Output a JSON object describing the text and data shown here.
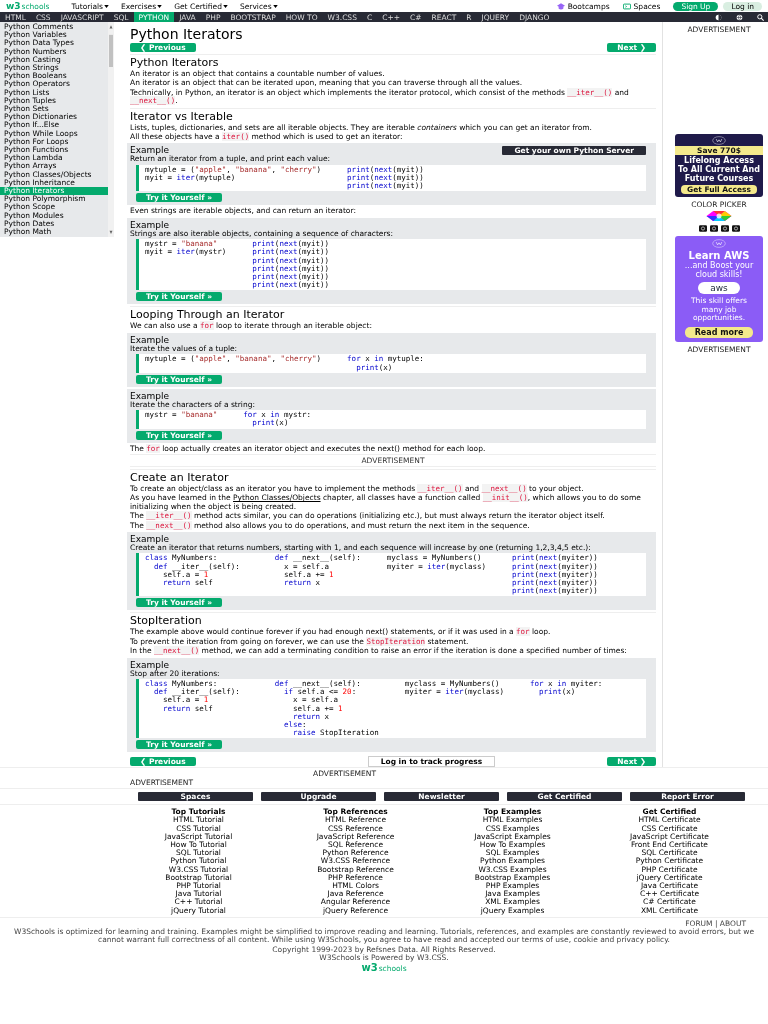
{
  "header": {
    "logo": {
      "mark": "w3",
      "sub": "schools"
    },
    "menus": [
      {
        "label": "Tutorials"
      },
      {
        "label": "Exercises"
      },
      {
        "label": "Get Certified"
      },
      {
        "label": "Services"
      }
    ],
    "links": [
      {
        "label": "Bootcamps"
      },
      {
        "label": "Spaces"
      }
    ],
    "sign_up": "Sign Up",
    "log_in": "Log in"
  },
  "nav": [
    {
      "label": "HTML",
      "selected": false
    },
    {
      "label": "CSS",
      "selected": false
    },
    {
      "label": "JAVASCRIPT",
      "selected": false
    },
    {
      "label": "SQL",
      "selected": false
    },
    {
      "label": "PYTHON",
      "selected": true
    },
    {
      "label": "JAVA",
      "selected": false
    },
    {
      "label": "PHP",
      "selected": false
    },
    {
      "label": "BOOTSTRAP",
      "selected": false
    },
    {
      "label": "HOW TO",
      "selected": false
    },
    {
      "label": "W3.CSS",
      "selected": false
    },
    {
      "label": "C",
      "selected": false
    },
    {
      "label": "C++",
      "selected": false
    },
    {
      "label": "C#",
      "selected": false
    },
    {
      "label": "REACT",
      "selected": false
    },
    {
      "label": "R",
      "selected": false
    },
    {
      "label": "JQUERY",
      "selected": false
    },
    {
      "label": "DJANGO",
      "selected": false
    }
  ],
  "sidebar": [
    {
      "label": "Python Comments",
      "selected": false
    },
    {
      "label": "Python Variables",
      "selected": false
    },
    {
      "label": "Python Data Types",
      "selected": false
    },
    {
      "label": "Python Numbers",
      "selected": false
    },
    {
      "label": "Python Casting",
      "selected": false
    },
    {
      "label": "Python Strings",
      "selected": false
    },
    {
      "label": "Python Booleans",
      "selected": false
    },
    {
      "label": "Python Operators",
      "selected": false
    },
    {
      "label": "Python Lists",
      "selected": false
    },
    {
      "label": "Python Tuples",
      "selected": false
    },
    {
      "label": "Python Sets",
      "selected": false
    },
    {
      "label": "Python Dictionaries",
      "selected": false
    },
    {
      "label": "Python If...Else",
      "selected": false
    },
    {
      "label": "Python While Loops",
      "selected": false
    },
    {
      "label": "Python For Loops",
      "selected": false
    },
    {
      "label": "Python Functions",
      "selected": false
    },
    {
      "label": "Python Lambda",
      "selected": false
    },
    {
      "label": "Python Arrays",
      "selected": false
    },
    {
      "label": "Python Classes/Objects",
      "selected": false
    },
    {
      "label": "Python Inheritance",
      "selected": false
    },
    {
      "label": "Python Iterators",
      "selected": true
    },
    {
      "label": "Python Polymorphism",
      "selected": false
    },
    {
      "label": "Python Scope",
      "selected": false
    },
    {
      "label": "Python Modules",
      "selected": false
    },
    {
      "label": "Python Dates",
      "selected": false
    },
    {
      "label": "Python Math",
      "selected": false
    }
  ],
  "content": [
    {
      "kind": "title",
      "text": "Python Iterators"
    },
    {
      "kind": "pager",
      "previous": "❮ Previous",
      "next": "Next ❯"
    },
    {
      "kind": "heading",
      "text": "Python Iterators"
    },
    {
      "kind": "paragraph",
      "parts": [
        "An iterator is an object that contains a countable number of values."
      ]
    },
    {
      "kind": "paragraph",
      "parts": [
        "An iterator is an object that can be iterated upon, meaning that you can traverse through all the values."
      ]
    },
    {
      "kind": "paragraph",
      "parts": [
        "Technically, in Python, an iterator is an object which implements the iterator protocol, which consist of the methods ",
        {
          "text": "__iter__()",
          "kind": "code"
        },
        " and ",
        {
          "text": "__next__()",
          "kind": "code"
        },
        "."
      ]
    },
    {
      "kind": "heading",
      "text": "Iterator vs Iterable"
    },
    {
      "kind": "paragraph",
      "parts": [
        "Lists, tuples, dictionaries, and sets are all iterable objects. They are iterable ",
        {
          "text": "containers",
          "kind": "em"
        },
        " which you can get an iterator from."
      ]
    },
    {
      "kind": "paragraph",
      "parts": [
        "All these objects have a ",
        {
          "text": "iter()",
          "kind": "code"
        },
        " method which is used to get an iterator:"
      ]
    },
    {
      "kind": "example",
      "title": "Example",
      "server_button": "Get your own Python Server",
      "description": "Return an iterator from a tuple, and print each value:",
      "button": "Try it Yourself »",
      "code": [
        [
          [
            "mytuple = (",
            {
              "text": "\"apple\"",
              "kind": "str"
            },
            ", ",
            {
              "text": "\"banana\"",
              "kind": "str"
            },
            ", ",
            {
              "text": "\"cherry\"",
              "kind": "str"
            },
            ")"
          ],
          [
            "myit = ",
            {
              "text": "iter",
              "kind": "kw"
            },
            "(mytuple)"
          ]
        ],
        [
          [
            {
              "text": "print",
              "kind": "kw"
            },
            "(",
            {
              "text": "next",
              "kind": "kw"
            },
            "(myit))"
          ],
          [
            {
              "text": "print",
              "kind": "kw"
            },
            "(",
            {
              "text": "next",
              "kind": "kw"
            },
            "(myit))"
          ],
          [
            {
              "text": "print",
              "kind": "kw"
            },
            "(",
            {
              "text": "next",
              "kind": "kw"
            },
            "(myit))"
          ]
        ]
      ]
    },
    {
      "kind": "paragraph",
      "parts": [
        "Even strings are iterable objects, and can return an iterator:"
      ]
    },
    {
      "kind": "example",
      "title": "Example",
      "description": "Strings are also iterable objects, containing a sequence of characters:",
      "button": "Try it Yourself »",
      "code": [
        [
          [
            "mystr = ",
            {
              "text": "\"banana\"",
              "kind": "str"
            }
          ],
          [
            "myit = ",
            {
              "text": "iter",
              "kind": "kw"
            },
            "(mystr)"
          ]
        ],
        [
          [
            {
              "text": "print",
              "kind": "kw"
            },
            "(",
            {
              "text": "next",
              "kind": "kw"
            },
            "(myit))"
          ],
          [
            {
              "text": "print",
              "kind": "kw"
            },
            "(",
            {
              "text": "next",
              "kind": "kw"
            },
            "(myit))"
          ],
          [
            {
              "text": "print",
              "kind": "kw"
            },
            "(",
            {
              "text": "next",
              "kind": "kw"
            },
            "(myit))"
          ],
          [
            {
              "text": "print",
              "kind": "kw"
            },
            "(",
            {
              "text": "next",
              "kind": "kw"
            },
            "(myit))"
          ],
          [
            {
              "text": "print",
              "kind": "kw"
            },
            "(",
            {
              "text": "next",
              "kind": "kw"
            },
            "(myit))"
          ],
          [
            {
              "text": "print",
              "kind": "kw"
            },
            "(",
            {
              "text": "next",
              "kind": "kw"
            },
            "(myit))"
          ]
        ]
      ]
    },
    {
      "kind": "heading",
      "text": "Looping Through an Iterator"
    },
    {
      "kind": "paragraph",
      "parts": [
        "We can also use a ",
        {
          "text": "for",
          "kind": "code"
        },
        " loop to iterate through an iterable object:"
      ]
    },
    {
      "kind": "example",
      "title": "Example",
      "description": "Iterate the values of a tuple:",
      "button": "Try it Yourself »",
      "code": [
        [
          [
            "mytuple = (",
            {
              "text": "\"apple\"",
              "kind": "str"
            },
            ", ",
            {
              "text": "\"banana\"",
              "kind": "str"
            },
            ", ",
            {
              "text": "\"cherry\"",
              "kind": "str"
            },
            ")"
          ]
        ],
        [
          [
            {
              "text": "for",
              "kind": "kw"
            },
            " x ",
            {
              "text": "in",
              "kind": "kw"
            },
            " mytuple:"
          ],
          [
            {
              "text": "  print",
              "kind": "kw"
            },
            "(x)"
          ]
        ]
      ]
    },
    {
      "kind": "example",
      "title": "Example",
      "description": "Iterate the characters of a string:",
      "button": "Try it Yourself »",
      "code": [
        [
          [
            "mystr = ",
            {
              "text": "\"banana\"",
              "kind": "str"
            }
          ]
        ],
        [
          [
            {
              "text": "for",
              "kind": "kw"
            },
            " x ",
            {
              "text": "in",
              "kind": "kw"
            },
            " mystr:"
          ],
          [
            {
              "text": "  print",
              "kind": "kw"
            },
            "(x)"
          ]
        ]
      ]
    },
    {
      "kind": "paragraph",
      "parts": [
        "The ",
        {
          "text": "for",
          "kind": "code"
        },
        " loop actually creates an iterator object and executes the next() method for each loop."
      ]
    },
    {
      "kind": "ad",
      "text": "ADVERTISEMENT"
    },
    {
      "kind": "heading",
      "text": "Create an Iterator"
    },
    {
      "kind": "paragraph",
      "parts": [
        "To create an object/class as an iterator you have to implement the methods ",
        {
          "text": "__iter__()",
          "kind": "code"
        },
        " and ",
        {
          "text": "__next__()",
          "kind": "code"
        },
        " to your object."
      ]
    },
    {
      "kind": "paragraph",
      "parts": [
        "As you have learned in the ",
        {
          "text": "Python Classes/Objects",
          "kind": "link"
        },
        " chapter, all classes have a function called ",
        {
          "text": "__init__()",
          "kind": "code"
        },
        ", which allows you to do some initializing when the object is being created."
      ]
    },
    {
      "kind": "paragraph",
      "parts": [
        "The ",
        {
          "text": "__iter__()",
          "kind": "code"
        },
        " method acts similar, you can do operations (initializing etc.), but must always return the iterator object itself."
      ]
    },
    {
      "kind": "paragraph",
      "parts": [
        "The ",
        {
          "text": "__next__()",
          "kind": "code"
        },
        " method also allows you to do operations, and must return the next item in the sequence."
      ]
    },
    {
      "kind": "example",
      "title": "Example",
      "description": "Create an iterator that returns numbers, starting with 1, and each sequence will increase by one (returning 1,2,3,4,5 etc.):",
      "button": "Try it Yourself »",
      "code": [
        [
          [
            {
              "text": "class",
              "kind": "kw"
            },
            " MyNumbers:"
          ],
          [
            {
              "text": "  def",
              "kind": "kw"
            },
            " __iter__(self):"
          ],
          [
            "    self.a = ",
            {
              "text": "1",
              "kind": "num"
            }
          ],
          [
            {
              "text": "    return",
              "kind": "kw"
            },
            " self"
          ]
        ],
        [
          [
            {
              "text": "  def",
              "kind": "kw"
            },
            " __next__(self):"
          ],
          [
            "    x = self.a"
          ],
          [
            "    self.a += ",
            {
              "text": "1",
              "kind": "num"
            }
          ],
          [
            {
              "text": "    return",
              "kind": "kw"
            },
            " x"
          ]
        ],
        [
          [
            "myclass = MyNumbers()"
          ],
          [
            "myiter = ",
            {
              "text": "iter",
              "kind": "kw"
            },
            "(myclass)"
          ]
        ],
        [
          [
            {
              "text": "print",
              "kind": "kw"
            },
            "(",
            {
              "text": "next",
              "kind": "kw"
            },
            "(myiter))"
          ],
          [
            {
              "text": "print",
              "kind": "kw"
            },
            "(",
            {
              "text": "next",
              "kind": "kw"
            },
            "(myiter))"
          ],
          [
            {
              "text": "print",
              "kind": "kw"
            },
            "(",
            {
              "text": "next",
              "kind": "kw"
            },
            "(myiter))"
          ],
          [
            {
              "text": "print",
              "kind": "kw"
            },
            "(",
            {
              "text": "next",
              "kind": "kw"
            },
            "(myiter))"
          ],
          [
            {
              "text": "print",
              "kind": "kw"
            },
            "(",
            {
              "text": "next",
              "kind": "kw"
            },
            "(myiter))"
          ]
        ]
      ]
    },
    {
      "kind": "heading",
      "text": "StopIteration"
    },
    {
      "kind": "paragraph",
      "parts": [
        "The example above would continue forever if you had enough next() statements, or if it was used in a ",
        {
          "text": "for",
          "kind": "code"
        },
        " loop."
      ]
    },
    {
      "kind": "paragraph",
      "parts": [
        "To prevent the iteration from going on forever, we can use the ",
        {
          "text": "StopIteration",
          "kind": "code"
        },
        " statement."
      ]
    },
    {
      "kind": "paragraph",
      "parts": [
        "In the ",
        {
          "text": "__next__()",
          "kind": "code"
        },
        " method, we can add a terminating condition to raise an error if the iteration is done a specified number of times:"
      ]
    },
    {
      "kind": "example",
      "title": "Example",
      "description": "Stop after 20 iterations:",
      "button": "Try it Yourself »",
      "code": [
        [
          [
            {
              "text": "class",
              "kind": "kw"
            },
            " MyNumbers:"
          ],
          [
            {
              "text": "  def",
              "kind": "kw"
            },
            " __iter__(self):"
          ],
          [
            "    self.a = ",
            {
              "text": "1",
              "kind": "num"
            }
          ],
          [
            {
              "text": "    return",
              "kind": "kw"
            },
            " self"
          ]
        ],
        [
          [
            {
              "text": "  def",
              "kind": "kw"
            },
            " __next__(self):"
          ],
          [
            {
              "text": "    if",
              "kind": "kw"
            },
            " self.a <= ",
            {
              "text": "20",
              "kind": "num"
            },
            ":"
          ],
          [
            "      x = self.a"
          ],
          [
            "      self.a += ",
            {
              "text": "1",
              "kind": "num"
            }
          ],
          [
            {
              "text": "      return",
              "kind": "kw"
            },
            " x"
          ],
          [
            {
              "text": "    else",
              "kind": "kw"
            },
            ":"
          ],
          [
            {
              "text": "      raise",
              "kind": "kw"
            },
            " StopIteration"
          ]
        ],
        [
          [
            "myclass = MyNumbers()"
          ],
          [
            "myiter = ",
            {
              "text": "iter",
              "kind": "kw"
            },
            "(myclass)"
          ]
        ],
        [
          [
            {
              "text": "for",
              "kind": "kw"
            },
            " x ",
            {
              "text": "in",
              "kind": "kw"
            },
            " myiter:"
          ],
          [
            {
              "text": "  print",
              "kind": "kw"
            },
            "(x)"
          ]
        ]
      ]
    },
    {
      "kind": "pager",
      "previous": "❮ Previous",
      "progress": "Log in to track progress",
      "next": "Next ❯"
    }
  ],
  "right": {
    "ad_label": "ADVERTISEMENT",
    "promo": {
      "badge": "Save 770$",
      "headline": "Lifelong Access To All Current And Future Courses",
      "button": "Get Full Access"
    },
    "color_picker": "COLOR PICKER",
    "aws": {
      "headline": "Learn AWS",
      "subline": "...and Boost your cloud skills!",
      "logo": "aws",
      "body": "This skill offers many job opportunities.",
      "button": "Read more"
    },
    "ad_label_bottom": "ADVERTISEMENT"
  },
  "footer": {
    "ads": [
      "ADVERTISEMENT",
      "ADVERTISEMENT"
    ],
    "buttons": [
      "Spaces",
      "Upgrade",
      "Newsletter",
      "Get Certified",
      "Report Error"
    ],
    "columns": [
      {
        "title": "Top Tutorials",
        "links": [
          "HTML Tutorial",
          "CSS Tutorial",
          "JavaScript Tutorial",
          "How To Tutorial",
          "SQL Tutorial",
          "Python Tutorial",
          "W3.CSS Tutorial",
          "Bootstrap Tutorial",
          "PHP Tutorial",
          "Java Tutorial",
          "C++ Tutorial",
          "jQuery Tutorial"
        ]
      },
      {
        "title": "Top References",
        "links": [
          "HTML Reference",
          "CSS Reference",
          "JavaScript Reference",
          "SQL Reference",
          "Python Reference",
          "W3.CSS Reference",
          "Bootstrap Reference",
          "PHP Reference",
          "HTML Colors",
          "Java Reference",
          "Angular Reference",
          "jQuery Reference"
        ]
      },
      {
        "title": "Top Examples",
        "links": [
          "HTML Examples",
          "CSS Examples",
          "JavaScript Examples",
          "How To Examples",
          "SQL Examples",
          "Python Examples",
          "W3.CSS Examples",
          "Bootstrap Examples",
          "PHP Examples",
          "Java Examples",
          "XML Examples",
          "jQuery Examples"
        ]
      },
      {
        "title": "Get Certified",
        "links": [
          "HTML Certificate",
          "CSS Certificate",
          "JavaScript Certificate",
          "Front End Certificate",
          "SQL Certificate",
          "Python Certificate",
          "PHP Certificate",
          "jQuery Certificate",
          "Java Certificate",
          "C++ Certificate",
          "C# Certificate",
          "XML Certificate"
        ]
      }
    ],
    "links": "FORUM | ABOUT",
    "disclaimer": "W3Schools is optimized for learning and training. Examples might be simplified to improve reading and learning. Tutorials, references, and examples are constantly reviewed to avoid errors, but we cannot warrant full correctness of all content. While using W3Schools, you agree to have read and accepted our terms of use, cookie and privacy policy.",
    "copyright": [
      "Copyright 1999-2023 by Refsnes Data. All Rights Reserved.",
      "W3Schools is Powered by W3.CSS."
    ],
    "logo": {
      "mark": "w3",
      "sub": "schools"
    }
  }
}
